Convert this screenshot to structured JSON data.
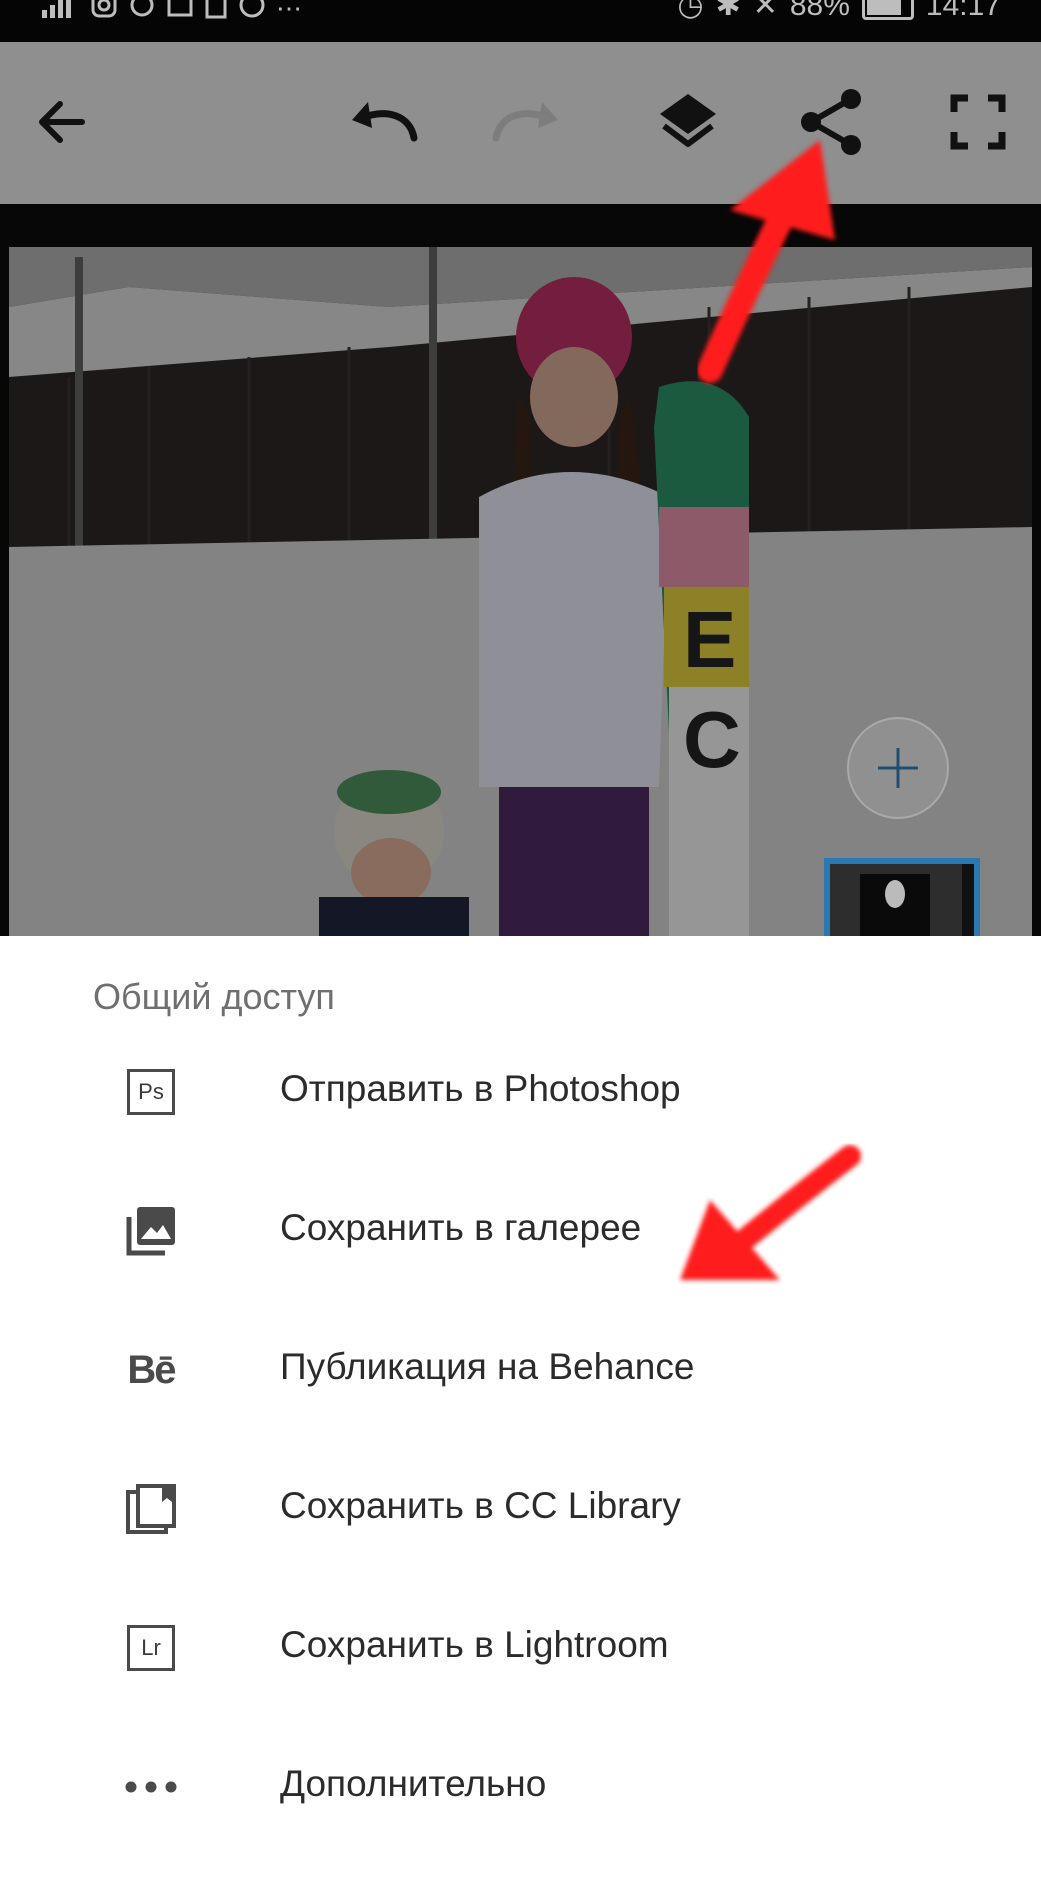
{
  "status_bar": {
    "battery": "88%",
    "time": "14:17"
  },
  "toolbar": {
    "icons": [
      "back-arrow-icon",
      "undo-icon",
      "redo-icon",
      "layers-icon",
      "share-icon",
      "fullscreen-icon"
    ]
  },
  "share_sheet": {
    "title": "Общий доступ",
    "items": [
      {
        "icon": "photoshop-icon",
        "icon_text": "Ps",
        "label": "Отправить в Photoshop"
      },
      {
        "icon": "gallery-icon",
        "label": "Сохранить в галерее"
      },
      {
        "icon": "behance-icon",
        "icon_text": "Bē",
        "label": "Публикация на Behance"
      },
      {
        "icon": "cc-library-icon",
        "label": "Сохранить в CC Library"
      },
      {
        "icon": "lightroom-icon",
        "icon_text": "Lr",
        "label": "Сохранить в Lightroom"
      },
      {
        "icon": "more-icon",
        "icon_text": "•••",
        "label": "Дополнительно"
      }
    ]
  },
  "colors": {
    "accent_annotation": "#ff1a1a",
    "sheet_background": "#ffffff",
    "toolbar_dimmed": "#8f8f8f"
  }
}
